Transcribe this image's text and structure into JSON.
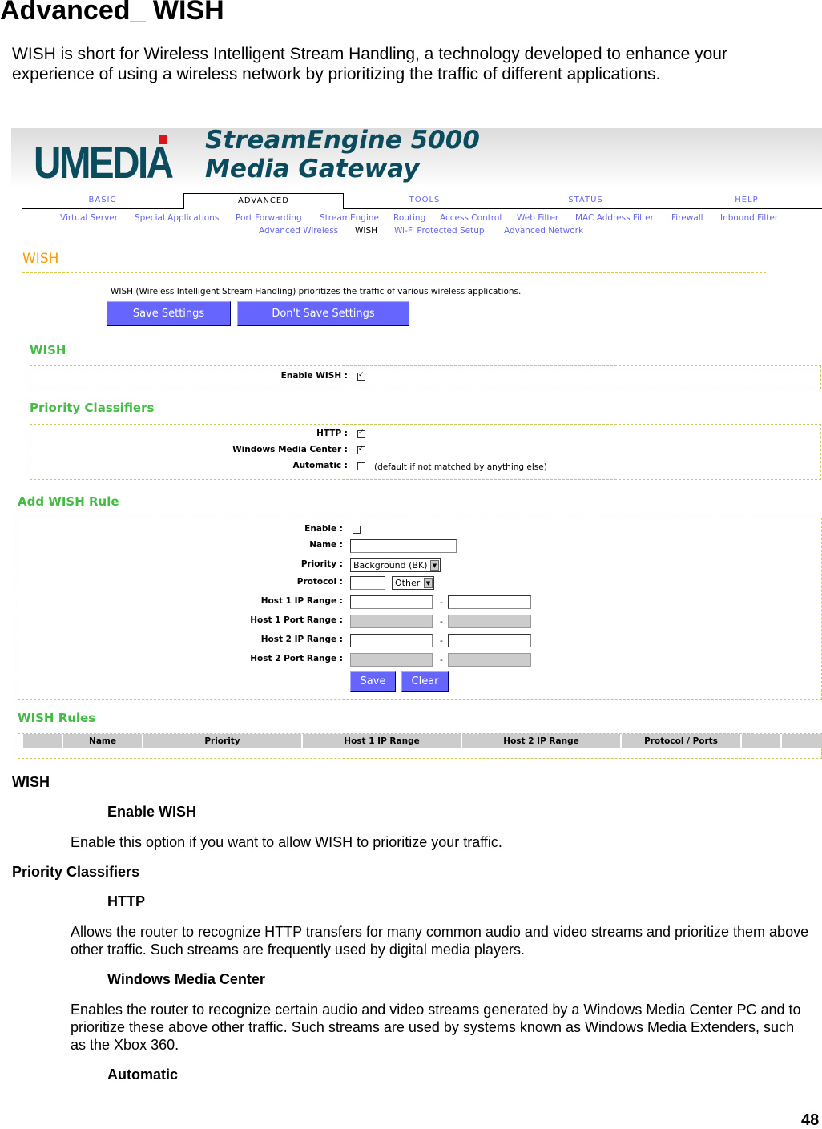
{
  "doc": {
    "title": "Advanced_ WISH",
    "intro": "WISH is short for Wireless Intelligent Stream Handling, a technology developed to enhance your experience of using a wireless network by prioritizing the traffic of different applications.",
    "page_number": "48",
    "sections": [
      {
        "heading": "WISH"
      },
      {
        "subheading": "Enable WISH"
      },
      {
        "text": "Enable this option if you want to allow WISH to prioritize your traffic."
      },
      {
        "heading": "Priority Classifiers"
      },
      {
        "subheading": "HTTP"
      },
      {
        "text": "Allows the router to recognize HTTP transfers for many common audio and video streams and prioritize them above other traffic. Such streams are frequently used by digital media players."
      },
      {
        "subheading": "Windows Media Center"
      },
      {
        "text": "Enables the router to recognize certain audio and video streams generated by a Windows Media Center PC and to prioritize these above other traffic. Such streams are used by systems known as Windows Media Extenders, such as the Xbox 360."
      },
      {
        "subheading": "Automatic"
      }
    ]
  },
  "ui": {
    "logo": "UMEDIA",
    "product_line1": "StreamEngine 5000",
    "product_line2": "Media Gateway",
    "tabs": [
      "BASIC",
      "ADVANCED",
      "TOOLS",
      "STATUS",
      "HELP"
    ],
    "active_tab": "ADVANCED",
    "subnav": [
      "Virtual Server",
      "Special Applications",
      "Port Forwarding",
      "StreamEngine",
      "Routing",
      "Access Control",
      "Web Filter",
      "MAC Address Filter",
      "Firewall",
      "Inbound Filter",
      "Advanced Wireless",
      "WISH",
      "Wi-Fi Protected Setup",
      "Advanced Network"
    ],
    "page_title": "WISH",
    "description": "WISH (Wireless Intelligent Stream Handling) prioritizes the traffic of various wireless applications.",
    "save_settings": "Save Settings",
    "dont_save": "Don't Save Settings",
    "wish_section": "WISH",
    "enable_wish_label": "Enable WISH :",
    "enable_wish": true,
    "classifiers_section": "Priority Classifiers",
    "http_label": "HTTP :",
    "http": true,
    "wmc_label": "Windows Media Center :",
    "wmc": true,
    "automatic_label": "Automatic :",
    "automatic": false,
    "automatic_note": "(default if not matched by anything else)",
    "add_rule_section": "Add WISH Rule",
    "rule": {
      "enable_label": "Enable :",
      "enable": false,
      "name_label": "Name :",
      "name": "",
      "priority_label": "Priority :",
      "priority": "Background (BK)",
      "protocol_label": "Protocol :",
      "protocol": "",
      "protocol_select": "Other",
      "host1_ip_label": "Host 1 IP Range :",
      "host1_port_label": "Host 1 Port Range :",
      "host2_ip_label": "Host 2 IP Range :",
      "host2_port_label": "Host 2 Port Range :",
      "sep": "-",
      "save": "Save",
      "clear": "Clear"
    },
    "rules_section": "WISH Rules",
    "rules_columns": [
      "",
      "Name",
      "Priority",
      "Host 1 IP Range",
      "Host 2 IP Range",
      "Protocol / Ports",
      "",
      ""
    ]
  },
  "colors": {
    "link": "#6666ee",
    "section_green": "#44bb44",
    "title_orange": "#ff9900",
    "button": "#6666ff",
    "logo": "#0a4c5e"
  }
}
